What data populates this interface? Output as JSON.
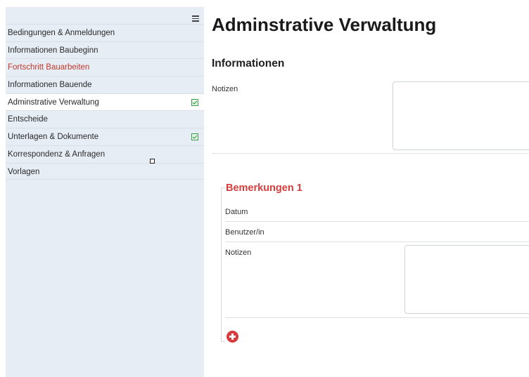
{
  "sidebar": {
    "items": [
      {
        "label": "Bedingungen & Anmeldungen",
        "state": "normal",
        "checked": false
      },
      {
        "label": "Informationen Baubeginn",
        "state": "normal",
        "checked": false
      },
      {
        "label": "Fortschritt Bauarbeiten",
        "state": "warning",
        "checked": false
      },
      {
        "label": "Informationen Bauende",
        "state": "normal",
        "checked": false
      },
      {
        "label": "Adminstrative Verwaltung",
        "state": "active",
        "checked": true
      },
      {
        "label": "Entscheide",
        "state": "normal",
        "checked": false
      },
      {
        "label": "Unterlagen & Dokumente",
        "state": "normal",
        "checked": true
      },
      {
        "label": "Korrespondenz & Anfragen",
        "state": "normal",
        "checked": false
      },
      {
        "label": "Vorlagen",
        "state": "normal",
        "checked": false
      }
    ]
  },
  "main": {
    "title": "Adminstrative Verwaltung",
    "section_title": "Informationen",
    "notes_label": "Notizen",
    "notes_value": "",
    "remarks_group": {
      "title": "Bemerkungen 1",
      "date_label": "Datum",
      "user_label": "Benutzer/in",
      "notes_label": "Notizen",
      "notes_value": ""
    }
  },
  "colors": {
    "sidebar_bg": "#e7edf5",
    "accent_red": "#d63c3c",
    "check_green": "#3c9a4a"
  },
  "icons": {
    "menu": "hamburger-icon",
    "check": "check-square-icon",
    "add": "plus-circle-icon"
  }
}
